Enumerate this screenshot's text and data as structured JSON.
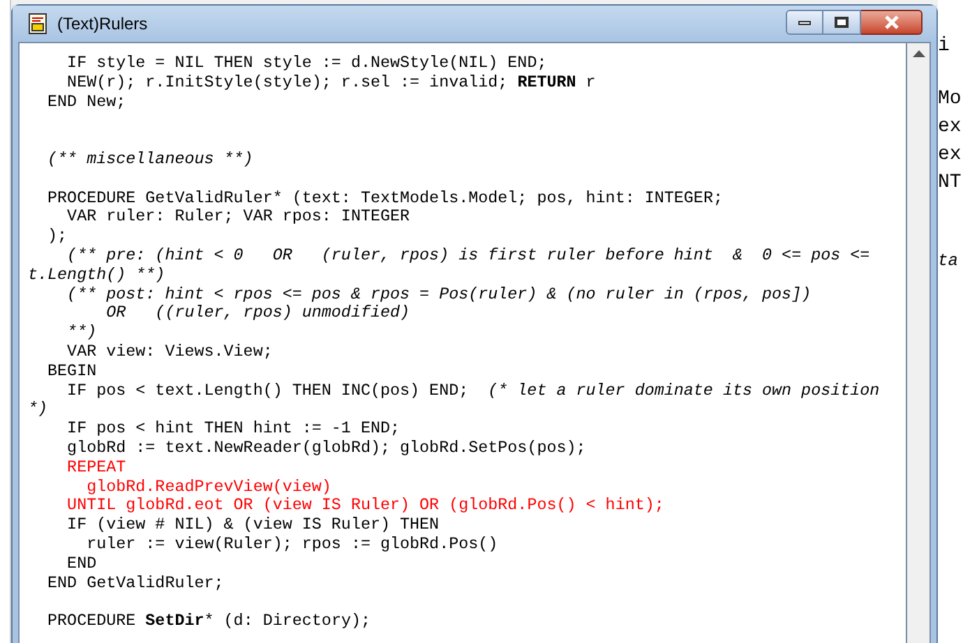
{
  "window": {
    "title": "(Text)Rulers"
  },
  "lines": [
    {
      "kind": "code",
      "color": "#000000",
      "text": "    IF style = NIL THEN style := d.NewStyle(NIL) END;"
    },
    {
      "kind": "code",
      "color": "#000000",
      "text": "    NEW(r); r.InitStyle(style); r.sel := invalid; **RETURN** r"
    },
    {
      "kind": "code",
      "color": "#000000",
      "text": "  END New;"
    },
    {
      "kind": "blank"
    },
    {
      "kind": "blank"
    },
    {
      "kind": "comment",
      "text": "  (** miscellaneous **)"
    },
    {
      "kind": "blank"
    },
    {
      "kind": "code",
      "color": "#000000",
      "text": "  PROCEDURE GetValidRuler* (text: TextModels.Model; pos, hint: INTEGER;"
    },
    {
      "kind": "code",
      "color": "#000000",
      "text": "    VAR ruler: Ruler; VAR rpos: INTEGER"
    },
    {
      "kind": "code",
      "color": "#000000",
      "text": "  );"
    },
    {
      "kind": "comment",
      "text": "    (** pre: (hint < 0   OR   (ruler, rpos) is first ruler before hint  &  0 <= pos <="
    },
    {
      "kind": "comment",
      "text": "t.Length() **)"
    },
    {
      "kind": "comment",
      "text": "    (** post: hint < rpos <= pos & rpos = Pos(ruler) & (no ruler in (rpos, pos])"
    },
    {
      "kind": "comment",
      "text": "        OR   ((ruler, rpos) unmodified)"
    },
    {
      "kind": "comment",
      "text": "    **)"
    },
    {
      "kind": "code",
      "color": "#000000",
      "text": "    VAR view: Views.View;"
    },
    {
      "kind": "code",
      "color": "#000000",
      "text": "  BEGIN"
    },
    {
      "kind": "code",
      "color": "#000000",
      "text": "    IF pos < text.Length() THEN INC(pos) END;",
      "comment": "(* let a ruler dominate its own position"
    },
    {
      "kind": "comment",
      "text": "*)"
    },
    {
      "kind": "code",
      "color": "#000000",
      "text": "    IF pos < hint THEN hint := -1 END;"
    },
    {
      "kind": "code",
      "color": "#000000",
      "text": "    globRd := text.NewReader(globRd); globRd.SetPos(pos);"
    },
    {
      "kind": "code",
      "color": "#ff0000",
      "text": "    REPEAT"
    },
    {
      "kind": "code",
      "color": "#ff0000",
      "text": "      globRd.ReadPrevView(view)"
    },
    {
      "kind": "code",
      "color": "#ff0000",
      "text": "    UNTIL globRd.eot OR (view IS Ruler) OR (globRd.Pos() < hint);"
    },
    {
      "kind": "code",
      "color": "#000000",
      "text": "    IF (view # NIL) & (view IS Ruler) THEN"
    },
    {
      "kind": "code",
      "color": "#000000",
      "text": "      ruler := view(Ruler); rpos := globRd.Pos()"
    },
    {
      "kind": "code",
      "color": "#000000",
      "text": "    END"
    },
    {
      "kind": "code",
      "color": "#000000",
      "text": "  END GetValidRuler;"
    },
    {
      "kind": "blank"
    },
    {
      "kind": "declaration",
      "color": "#000000",
      "before": "  PROCEDURE ",
      "name": "SetDir",
      "after": "* (d: Directory);"
    }
  ],
  "background_window": {
    "lines": [
      "i",
      "Mo",
      "ex",
      "ex",
      "NT",
      "ta"
    ]
  }
}
